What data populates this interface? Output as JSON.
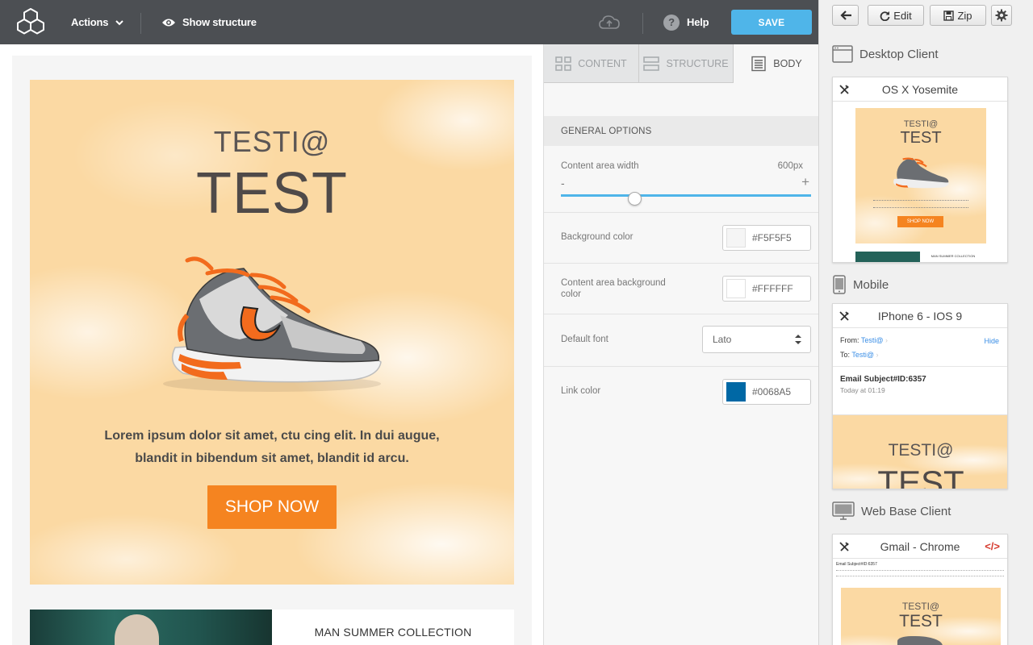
{
  "topbar": {
    "actions_label": "Actions",
    "show_structure_label": "Show structure",
    "help_label": "Help",
    "save_label": "SAVE"
  },
  "email": {
    "title_line1": "TESTI@",
    "title_line2": "TEST",
    "body_text": "Lorem ipsum dolor sit amet, ctu cing elit. In dui augue, blandit in bibendum sit amet, blandit id arcu.",
    "cta_label": "SHOP NOW",
    "second_section_title": "MAN SUMMER COLLECTION"
  },
  "settings": {
    "tabs": [
      {
        "label": "CONTENT"
      },
      {
        "label": "STRUCTURE"
      },
      {
        "label": "BODY"
      }
    ],
    "section_title": "GENERAL OPTIONS",
    "content_width": {
      "label": "Content area width",
      "value": "600px",
      "minus": "-",
      "plus": "+"
    },
    "background_color": {
      "label": "Background color",
      "value": "#F5F5F5"
    },
    "content_bg_color": {
      "label": "Content area background color",
      "value": "#FFFFFF"
    },
    "default_font": {
      "label": "Default font",
      "value": "Lato"
    },
    "link_color": {
      "label": "Link color",
      "value": "#0068A5"
    }
  },
  "preview": {
    "edit_label": "Edit",
    "zip_label": "Zip",
    "groups": [
      {
        "label": "Desktop Client"
      },
      {
        "label": "Mobile"
      },
      {
        "label": "Web Base Client"
      }
    ],
    "cards": [
      {
        "title": "OS X Yosemite",
        "mini_title1": "TESTI@",
        "mini_title2": "TEST",
        "mini_shop": "SHOP NOW",
        "mini_second": "MAN SUMMER COLLECTION"
      },
      {
        "title": "IPhone 6 - IOS 9",
        "from_label": "From:",
        "from_value": "Testi@",
        "to_label": "To:",
        "to_value": "Testi@",
        "hide_label": "Hide",
        "subject": "Email Subject#ID:6357",
        "time": "Today at 01:19",
        "mini_title1": "TESTI@",
        "mini_title2": "TEST"
      },
      {
        "title": "Gmail - Chrome",
        "mini_subject": "Email Subject#ID:6357",
        "mini_title1": "TESTI@",
        "mini_title2": "TEST"
      }
    ]
  },
  "colors": {
    "topbar": "#4c4f53",
    "accent": "#4fb5e9",
    "cta": "#f58420",
    "hero_bg": "#fbd9a3",
    "link": "#0068A5"
  }
}
